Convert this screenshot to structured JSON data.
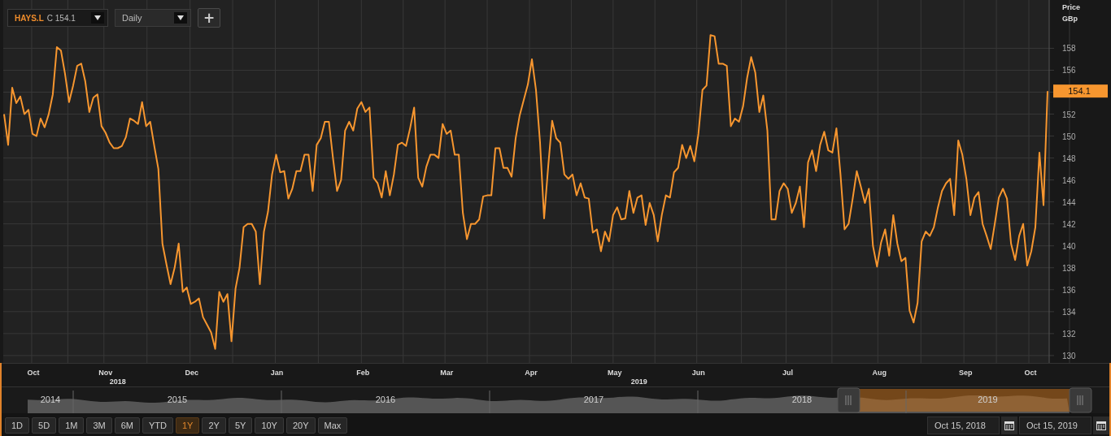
{
  "toolbar": {
    "quote": "C 154.1",
    "interval": "Daily",
    "add_button": "+"
  },
  "y_axis": {
    "title": "Price",
    "unit": "GBp"
  },
  "last_price": "154.1",
  "x_axis": {
    "months": [
      "Oct",
      "Nov",
      "Dec",
      "Jan",
      "Feb",
      "Mar",
      "Apr",
      "May",
      "Jun",
      "Jul",
      "Aug",
      "Sep",
      "Oct"
    ],
    "years": [
      "2018",
      "2019"
    ]
  },
  "chart_data": {
    "type": "line",
    "grid": true,
    "ylim": [
      129.4,
      162.4
    ],
    "yticks": [
      130,
      132,
      134,
      136,
      138,
      140,
      142,
      144,
      146,
      148,
      150,
      152,
      156,
      158
    ],
    "series": [
      {
        "name": "HAYS.L",
        "color": "#f7962f",
        "values": [
          152,
          149.2,
          154.4,
          153,
          153.6,
          152,
          152.4,
          150.2,
          150,
          151.6,
          150.8,
          152,
          153.8,
          158.1,
          157.8,
          155.7,
          153.1,
          154.6,
          156.4,
          156.6,
          155,
          152.2,
          153.5,
          153.8,
          150.9,
          150.3,
          149.4,
          148.9,
          148.9,
          149.1,
          149.9,
          151.6,
          151.4,
          151.1,
          153.1,
          150.9,
          151.3,
          149.1,
          147,
          140.2,
          138.3,
          136.5,
          138,
          140.2,
          135.8,
          136.2,
          134.7,
          134.9,
          135.2,
          133.5,
          132.8,
          132.1,
          130.6,
          135.8,
          134.9,
          135.6,
          131.3,
          136.1,
          138,
          141.7,
          142,
          142,
          141.3,
          136.5,
          141.3,
          143.1,
          146.5,
          148.3,
          146.7,
          146.8,
          144.3,
          145.2,
          146.8,
          146.8,
          148.3,
          148.3,
          145,
          149.2,
          149.8,
          151.3,
          151.3,
          148,
          145,
          146,
          150.5,
          151.3,
          150.5,
          152.5,
          153.1,
          152.2,
          152.6,
          146.2,
          145.7,
          144.4,
          146.8,
          144.6,
          146.5,
          149.2,
          149.4,
          149.1,
          150.7,
          152.6,
          146.2,
          145.4,
          147.2,
          148.3,
          148.3,
          148,
          151.1,
          150.2,
          150.5,
          148.3,
          148.3,
          143,
          140.6,
          142,
          142,
          142.4,
          144.5,
          144.6,
          144.6,
          148.9,
          148.9,
          147.1,
          147.1,
          146.3,
          149.8,
          151.9,
          153.3,
          154.7,
          157,
          154.2,
          149.4,
          142.5,
          147.2,
          151.4,
          149.8,
          149.4,
          146.5,
          146.1,
          146.5,
          144.6,
          145.7,
          144.4,
          144.3,
          141.2,
          141.5,
          139.5,
          141.3,
          140.4,
          142.8,
          143.5,
          142.4,
          142.5,
          145,
          143,
          144.4,
          144.6,
          141.9,
          143.9,
          142.8,
          140.4,
          142.8,
          144.6,
          144.4,
          146.7,
          147.1,
          149.2,
          148,
          149.1,
          147.7,
          150.2,
          154.2,
          154.6,
          159.2,
          159.1,
          156.6,
          156.6,
          156.4,
          150.9,
          151.6,
          151.3,
          152.7,
          155.3,
          157.2,
          155.8,
          152.2,
          153.7,
          150.5,
          142.4,
          142.4,
          145,
          145.7,
          145.2,
          143,
          143.9,
          145.4,
          141.7,
          147.6,
          148.7,
          146.8,
          149.2,
          150.4,
          148.7,
          148.5,
          150.7,
          146.5,
          141.5,
          142,
          144.3,
          146.8,
          145.4,
          143.9,
          145.2,
          140,
          138.1,
          140.3,
          141.5,
          139.1,
          142.8,
          140.2,
          138.6,
          138.9,
          134.1,
          133,
          134.8,
          140.4,
          141.3,
          140.9,
          141.7,
          143.5,
          145,
          145.7,
          146.1,
          142.8,
          149.6,
          148.3,
          146.1,
          142.8,
          144.4,
          144.9,
          142,
          140.9,
          139.7,
          142,
          144.4,
          145.2,
          144.3,
          140.2,
          138.7,
          140.9,
          142,
          138.2,
          139.5,
          141.7,
          148.5,
          143.7,
          154.1
        ]
      }
    ]
  },
  "navigator": {
    "years": [
      "2014",
      "2015",
      "2016",
      "2017",
      "2018",
      "2019"
    ]
  },
  "ranges": [
    {
      "label": "1D",
      "selected": false
    },
    {
      "label": "5D",
      "selected": false
    },
    {
      "label": "1M",
      "selected": false
    },
    {
      "label": "3M",
      "selected": false
    },
    {
      "label": "6M",
      "selected": false
    },
    {
      "label": "YTD",
      "selected": false
    },
    {
      "label": "1Y",
      "selected": true
    },
    {
      "label": "2Y",
      "selected": false
    },
    {
      "label": "5Y",
      "selected": false
    },
    {
      "label": "10Y",
      "selected": false
    },
    {
      "label": "20Y",
      "selected": false
    },
    {
      "label": "Max",
      "selected": false
    }
  ],
  "date_range": {
    "from": "Oct 15, 2018",
    "to": "Oct 15, 2019"
  }
}
